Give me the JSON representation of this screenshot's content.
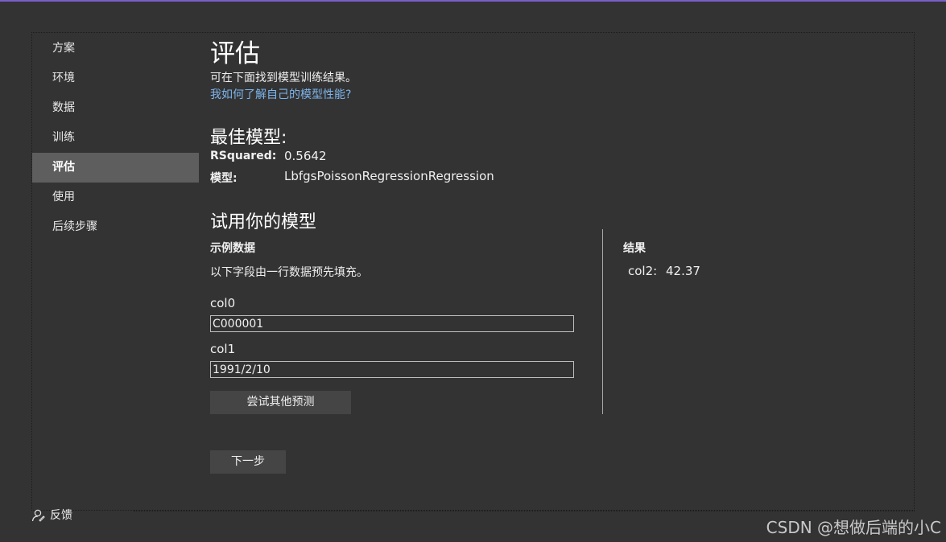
{
  "sidebar": {
    "items": [
      {
        "label": "方案"
      },
      {
        "label": "环境"
      },
      {
        "label": "数据"
      },
      {
        "label": "训练"
      },
      {
        "label": "评估"
      },
      {
        "label": "使用"
      },
      {
        "label": "后续步骤"
      }
    ],
    "active_index": 4
  },
  "header": {
    "title": "评估",
    "subtitle": "可在下面找到模型训练结果。",
    "help_link": "我如何了解自己的模型性能?"
  },
  "best_model": {
    "title": "最佳模型:",
    "metric_label": "RSquared:",
    "metric_value": "0.5642",
    "model_label": "模型:",
    "model_value": "LbfgsPoissonRegressionRegression"
  },
  "try_model": {
    "title": "试用你的模型",
    "sample_heading": "示例数据",
    "sample_desc": "以下字段由一行数据预先填充。",
    "fields": [
      {
        "label": "col0",
        "value": "C000001"
      },
      {
        "label": "col1",
        "value": "1991/2/10"
      }
    ],
    "predict_button": "尝试其他预测",
    "results_heading": "结果",
    "result_label": "col2:",
    "result_value": "42.37"
  },
  "next_button": "下一步",
  "feedback_label": "反馈",
  "watermark": "CSDN @想做后端的小C",
  "colors": {
    "accent_top": "#7a5fc9",
    "background": "#333333",
    "link": "#7db5ec",
    "active_nav": "#5e5e5e"
  }
}
